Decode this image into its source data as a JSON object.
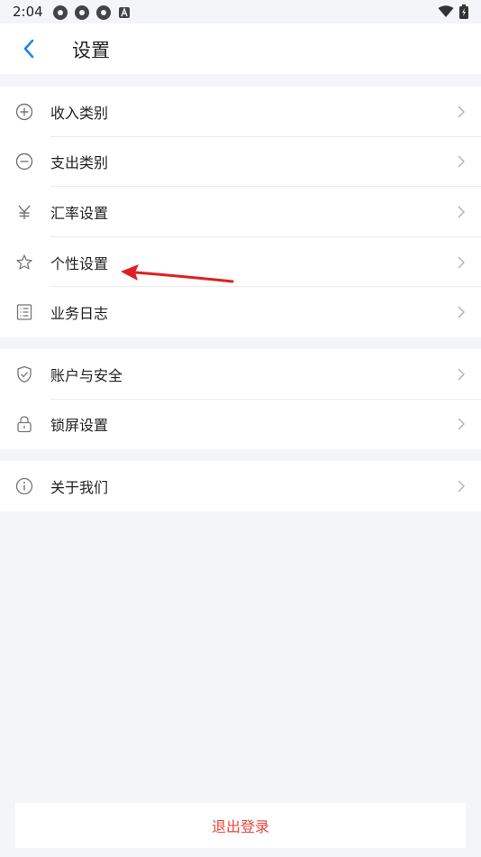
{
  "status": {
    "time": "2:04"
  },
  "header": {
    "title": "设置"
  },
  "groups": [
    {
      "items": [
        {
          "label": "收入类别",
          "icon": "plus-circle-icon"
        },
        {
          "label": "支出类别",
          "icon": "minus-circle-icon"
        },
        {
          "label": "汇率设置",
          "icon": "yen-icon"
        },
        {
          "label": "个性设置",
          "icon": "star-icon"
        },
        {
          "label": "业务日志",
          "icon": "list-icon"
        }
      ]
    },
    {
      "items": [
        {
          "label": "账户与安全",
          "icon": "shield-check-icon"
        },
        {
          "label": "锁屏设置",
          "icon": "lock-icon"
        }
      ]
    },
    {
      "items": [
        {
          "label": "关于我们",
          "icon": "info-icon"
        }
      ]
    }
  ],
  "logout": {
    "label": "退出登录"
  },
  "colors": {
    "accent": "#1e88e5",
    "danger": "#e8453c",
    "annotation": "#e02020"
  }
}
